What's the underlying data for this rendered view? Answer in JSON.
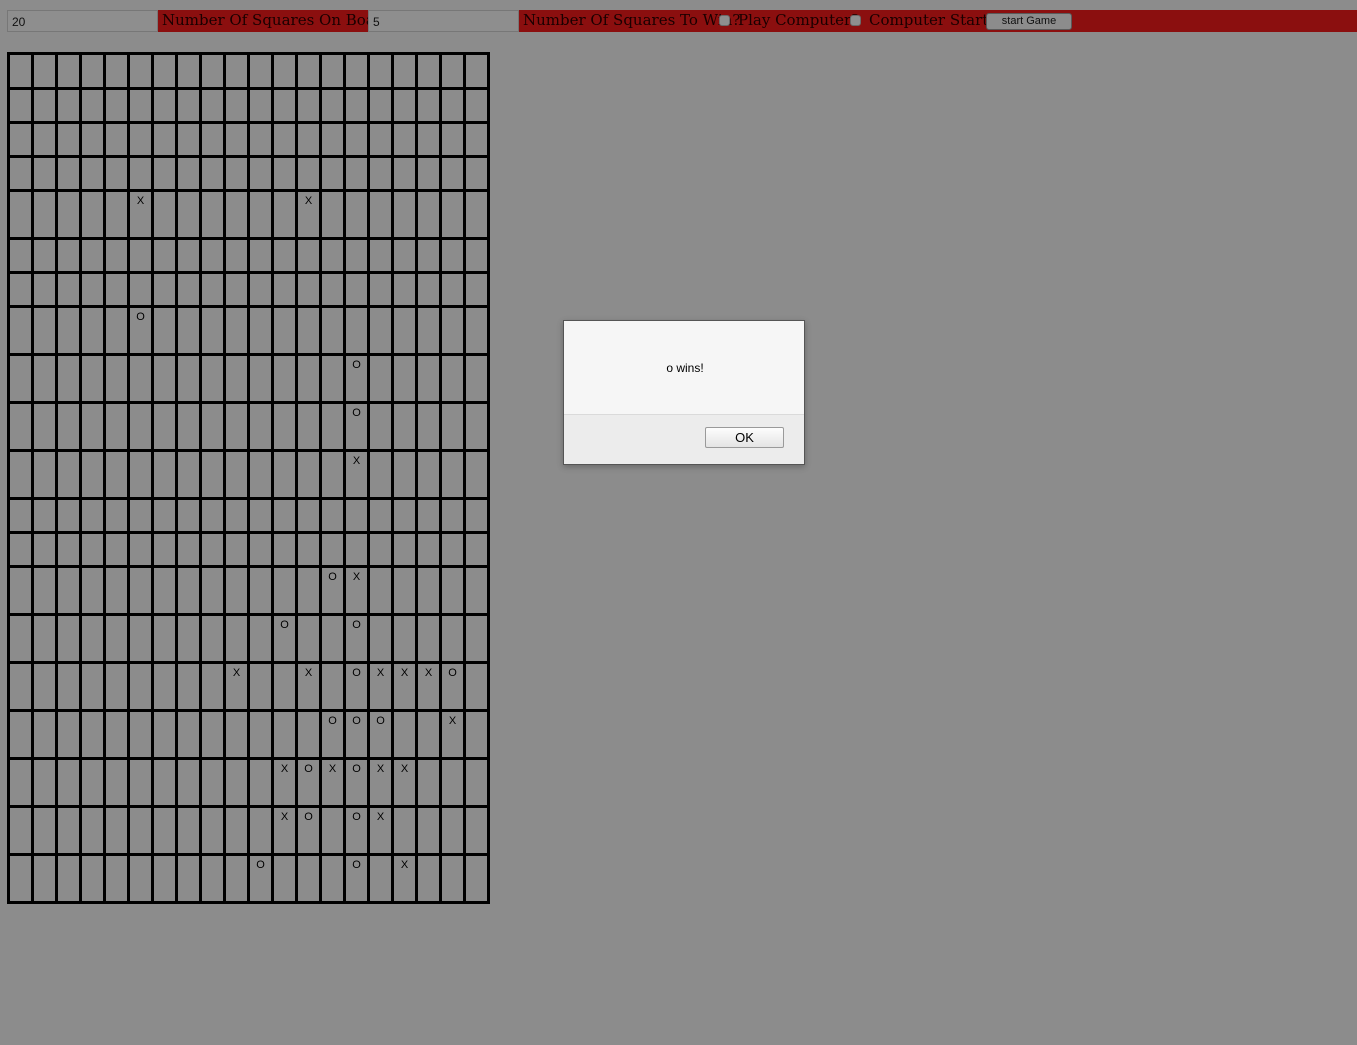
{
  "toolbar": {
    "board_size_value": "20",
    "board_size_label": "Number Of Squares On Board?",
    "win_length_value": "5",
    "win_length_label": "Number Of Squares To Win?",
    "play_computer_label": "Play Computer?",
    "play_computer_checked": false,
    "computer_starts_label": "Computer Starts?",
    "computer_starts_checked": false,
    "start_button_label": "start Game"
  },
  "colors": {
    "background": "#8c8c8c",
    "toolbar_red": "#8b0f0f",
    "grid_line": "#000000"
  },
  "board": {
    "size": 20,
    "rows": [
      [
        "",
        "",
        "",
        "",
        "",
        "",
        "",
        "",
        "",
        "",
        "",
        "",
        "",
        "",
        "",
        "",
        "",
        "",
        "",
        ""
      ],
      [
        "",
        "",
        "",
        "",
        "",
        "",
        "",
        "",
        "",
        "",
        "",
        "",
        "",
        "",
        "",
        "",
        "",
        "",
        "",
        ""
      ],
      [
        "",
        "",
        "",
        "",
        "",
        "",
        "",
        "",
        "",
        "",
        "",
        "",
        "",
        "",
        "",
        "",
        "",
        "",
        "",
        ""
      ],
      [
        "",
        "",
        "",
        "",
        "",
        "",
        "",
        "",
        "",
        "",
        "",
        "",
        "",
        "",
        "",
        "",
        "",
        "",
        "",
        ""
      ],
      [
        "",
        "",
        "",
        "",
        "",
        "X",
        "",
        "",
        "",
        "",
        "",
        "",
        "X",
        "",
        "",
        "",
        "",
        "",
        "",
        ""
      ],
      [
        "",
        "",
        "",
        "",
        "",
        "",
        "",
        "",
        "",
        "",
        "",
        "",
        "",
        "",
        "",
        "",
        "",
        "",
        "",
        ""
      ],
      [
        "",
        "",
        "",
        "",
        "",
        "",
        "",
        "",
        "",
        "",
        "",
        "",
        "",
        "",
        "",
        "",
        "",
        "",
        "",
        ""
      ],
      [
        "",
        "",
        "",
        "",
        "",
        "O",
        "",
        "",
        "",
        "",
        "",
        "",
        "",
        "",
        "",
        "",
        "",
        "",
        "",
        ""
      ],
      [
        "",
        "",
        "",
        "",
        "",
        "",
        "",
        "",
        "",
        "",
        "",
        "",
        "",
        "",
        "O",
        "",
        "",
        "",
        "",
        ""
      ],
      [
        "",
        "",
        "",
        "",
        "",
        "",
        "",
        "",
        "",
        "",
        "",
        "",
        "",
        "",
        "O",
        "",
        "",
        "",
        "",
        ""
      ],
      [
        "",
        "",
        "",
        "",
        "",
        "",
        "",
        "",
        "",
        "",
        "",
        "",
        "",
        "",
        "X",
        "",
        "",
        "",
        "",
        ""
      ],
      [
        "",
        "",
        "",
        "",
        "",
        "",
        "",
        "",
        "",
        "",
        "",
        "",
        "",
        "",
        "",
        "",
        "",
        "",
        "",
        ""
      ],
      [
        "",
        "",
        "",
        "",
        "",
        "",
        "",
        "",
        "",
        "",
        "",
        "",
        "",
        "",
        "",
        "",
        "",
        "",
        "",
        ""
      ],
      [
        "",
        "",
        "",
        "",
        "",
        "",
        "",
        "",
        "",
        "",
        "",
        "",
        "",
        "O",
        "X",
        "",
        "",
        "",
        "",
        ""
      ],
      [
        "",
        "",
        "",
        "",
        "",
        "",
        "",
        "",
        "",
        "",
        "",
        "O",
        "",
        "",
        "O",
        "",
        "",
        "",
        "",
        ""
      ],
      [
        "",
        "",
        "",
        "",
        "",
        "",
        "",
        "",
        "",
        "X",
        "",
        "",
        "X",
        "",
        "O",
        "X",
        "X",
        "X",
        "O",
        ""
      ],
      [
        "",
        "",
        "",
        "",
        "",
        "",
        "",
        "",
        "",
        "",
        "",
        "",
        "",
        "O",
        "O",
        "O",
        "",
        "",
        "X",
        ""
      ],
      [
        "",
        "",
        "",
        "",
        "",
        "",
        "",
        "",
        "",
        "",
        "",
        "X",
        "O",
        "X",
        "O",
        "X",
        "X",
        "",
        "",
        ""
      ],
      [
        "",
        "",
        "",
        "",
        "",
        "",
        "",
        "",
        "",
        "",
        "",
        "X",
        "O",
        "",
        "O",
        "X",
        "",
        "",
        "",
        ""
      ],
      [
        "",
        "",
        "",
        "",
        "",
        "",
        "",
        "",
        "",
        "",
        "O",
        "",
        "",
        "",
        "O",
        "",
        "X",
        "",
        "",
        ""
      ]
    ]
  },
  "dialog": {
    "message": "o wins!",
    "ok_label": "OK"
  }
}
